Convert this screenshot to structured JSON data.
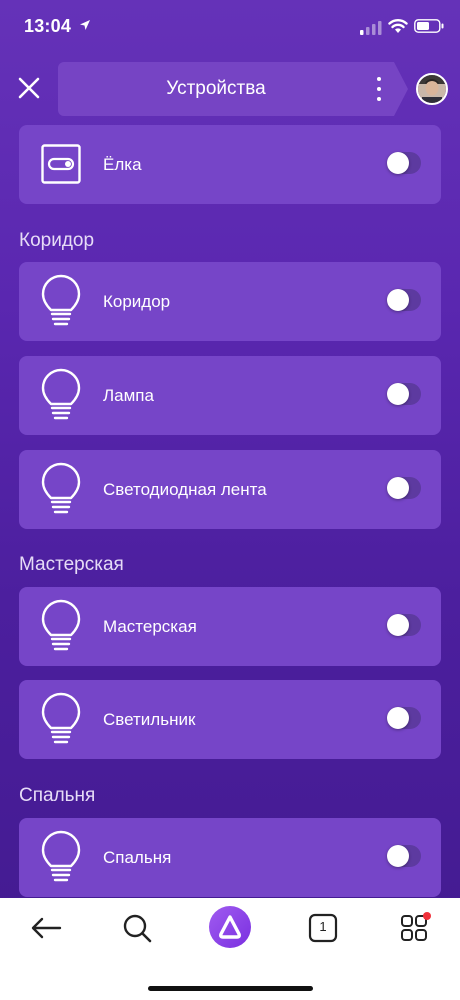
{
  "status_bar": {
    "time": "13:04"
  },
  "header": {
    "title": "Устройства"
  },
  "devices": {
    "elka": {
      "label": "Ёлка",
      "on": false
    },
    "koridor_section": "Коридор",
    "koridor": {
      "label": "Коридор",
      "on": false
    },
    "lampa": {
      "label": "Лампа",
      "on": false
    },
    "lenta": {
      "label": "Светодиодная лента",
      "on": false
    },
    "masterskaya_section": "Мастерская",
    "masterskaya": {
      "label": "Мастерская",
      "on": false
    },
    "svetilnik": {
      "label": "Светильник",
      "on": false
    },
    "spalnya_section": "Спальня",
    "spalnya": {
      "label": "Спальня",
      "on": false
    }
  },
  "tabbar": {
    "tabs_badge": "1",
    "notification_dot_color": "#f0303a"
  },
  "colors": {
    "background": "#5a27b0",
    "card": "#7645c8",
    "header_pill": "#7644c4",
    "alice_button": "#8a3fe8"
  },
  "icons": [
    "close-icon",
    "more-vertical-icon",
    "switch-device-icon",
    "light-bulb-icon",
    "back-arrow-icon",
    "search-icon",
    "alice-icon",
    "tabs-icon",
    "services-grid-icon"
  ]
}
